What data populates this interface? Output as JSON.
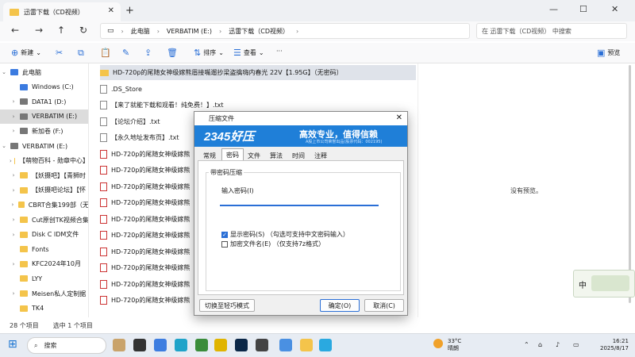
{
  "window": {
    "tab_title": "迅雷下载（CD视频）",
    "new_tab": "+",
    "minimize": "—",
    "maximize": "☐",
    "close": "✕"
  },
  "nav": {
    "back": "←",
    "forward": "→",
    "up": "↑",
    "refresh": "↻",
    "breadcrumb": [
      "此电脑",
      "VERBATIM (E:)",
      "迅雷下载（CD视频）"
    ],
    "search_placeholder": "在 迅雷下载（CD视频） 中搜索"
  },
  "toolbar": {
    "new_label": "新建",
    "sort_label": "排序",
    "view_label": "查看",
    "more_label": "···",
    "preview_label": "预览"
  },
  "sidebar": {
    "items": [
      {
        "label": "此电脑",
        "color": "#3b7be0"
      },
      {
        "label": "Windows (C:)",
        "color": "#3b7be0"
      },
      {
        "label": "DATA1 (D:)",
        "color": "#777777"
      },
      {
        "label": "VERBATIM (E:)",
        "color": "#777777"
      },
      {
        "label": "新加卷 (F:)",
        "color": "#777777"
      },
      {
        "label": "VERBATIM (E:)",
        "color": "#777777"
      },
      {
        "label": "【萌物百科 - 勋章中心】",
        "color": "#f4c44b"
      },
      {
        "label": "【妖摄吧】【青狮时",
        "color": "#f4c44b"
      },
      {
        "label": "【妖摄吧论坛】【怀",
        "color": "#f4c44b"
      },
      {
        "label": "CBRT合集199部（无",
        "color": "#f4c44b"
      },
      {
        "label": "Cut原创TK视频合集",
        "color": "#f4c44b"
      },
      {
        "label": "Disk C IDM文件",
        "color": "#f4c44b"
      },
      {
        "label": "Fonts",
        "color": "#f4c44b"
      },
      {
        "label": "KFC2024年10月",
        "color": "#f4c44b"
      },
      {
        "label": "LYY",
        "color": "#f4c44b"
      },
      {
        "label": "Meisen私人定制据",
        "color": "#f4c44b"
      },
      {
        "label": "TK4",
        "color": "#f4c44b"
      }
    ]
  },
  "files": [
    {
      "name": "HD-720p的尾随女神级嫁熊眉接嘴遛抄梁盗擒嗨内春光 22V【1.95G】（无密码）",
      "type": "folder"
    },
    {
      "name": ".DS_Store",
      "type": "txt"
    },
    {
      "name": "【来了就能下载和观看！纯免费！】.txt",
      "type": "txt"
    },
    {
      "name": "【论坛介绍】.txt",
      "type": "txt"
    },
    {
      "name": "【永久地址发布页】.txt",
      "type": "txt"
    },
    {
      "name": "HD-720p的尾随女神级嫁熊",
      "type": "pdf"
    },
    {
      "name": "HD-720p的尾随女神级嫁熊",
      "type": "pdf"
    },
    {
      "name": "HD-720p的尾随女神级嫁熊",
      "type": "pdf"
    },
    {
      "name": "HD-720p的尾随女神级嫁熊",
      "type": "pdf"
    },
    {
      "name": "HD-720p的尾随女神级嫁熊",
      "type": "pdf"
    },
    {
      "name": "HD-720p的尾随女神级嫁熊",
      "type": "pdf"
    },
    {
      "name": "HD-720p的尾随女神级嫁熊",
      "type": "pdf"
    },
    {
      "name": "HD-720p的尾随女神级嫁熊",
      "type": "pdf"
    },
    {
      "name": "HD-720p的尾随女神级嫁熊",
      "type": "pdf"
    },
    {
      "name": "HD-720p的尾随女神级嫁熊",
      "type": "pdf"
    }
  ],
  "files_col2": [
    "HD-720p的尾随女神级嫁",
    "HD-720p的尾随女神级嫁",
    "HD-720p的尾随女神级嫁",
    "HD-720p的尾随女神级嫁",
    "HD-720p的尾随女神级嫁",
    "HD-720p的尾随女神级嫁",
    "HD-720p的尾随女神级嫁",
    "HD-720p的尾随女神级嫁",
    "HD-720p的尾随女神级嫁",
    "HD-720p的尾随女神级嫁",
    "HD-720p的尾随女神级嫁",
    "HD-720p的尾随女神级嫁",
    "HD-720p的尾随女神级嫁",
    "HD-720p的尾随女神级嫁",
    "HD-720p的尾随女神级嫁"
  ],
  "preview": {
    "empty_text": "没有预览。"
  },
  "status": {
    "item_count": "28 个项目",
    "selected": "选中 1 个项目"
  },
  "dialog": {
    "title": "压缩文件",
    "banner_logo": "2345好压",
    "banner_slogan": "高效专业，值得信赖",
    "banner_sub": "A股上市公司荣誉出品(股票代码：002195)",
    "tabs": [
      "常规",
      "密码",
      "文件",
      "算法",
      "时间",
      "注释"
    ],
    "selected_tab": 1,
    "group_label": "带密码压缩",
    "password_label": "输入密码(I)",
    "password_value": "",
    "show_password_label": "显示密码(S)  （勾选可支持中文密码输入）",
    "show_password_checked": true,
    "encrypt_names_label": "加密文件名(E)  （仅支持7z格式）",
    "encrypt_names_checked": false,
    "simple_mode_button": "切换至轻巧模式",
    "ok_button": "确定(O)",
    "cancel_button": "取消(C)"
  },
  "widget": {
    "label": "中"
  },
  "taskbar": {
    "search_label": "搜索",
    "weather_temp": "33°C",
    "weather_desc": "晴朗",
    "time": "16:21",
    "date": "2025/8/17"
  }
}
